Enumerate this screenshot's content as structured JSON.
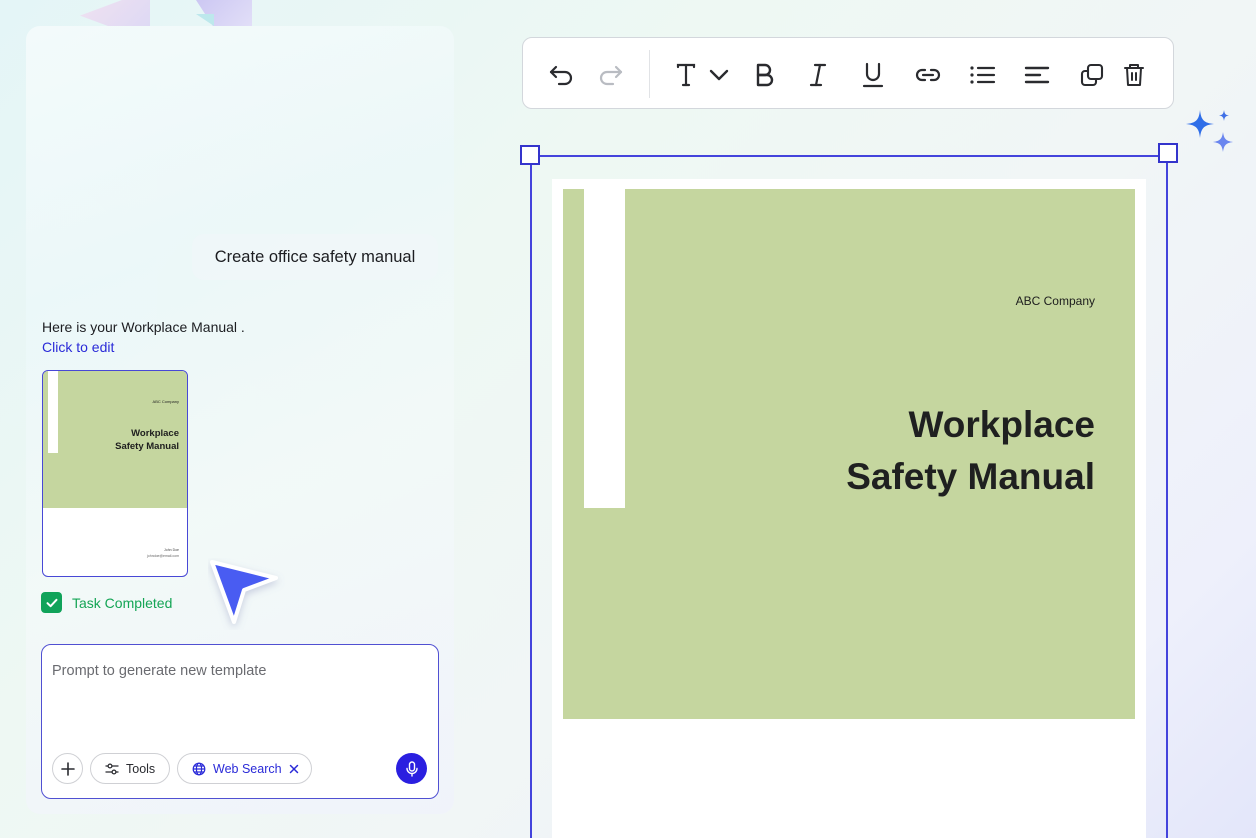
{
  "chat": {
    "user_message": "Create office safety manual",
    "assistant_message": "Here is your Workplace Manual .",
    "edit_link": "Click to edit",
    "thumbnail": {
      "company": "ABC Company",
      "title_line1": "Workplace",
      "title_line2": "Safety Manual",
      "footer_name": "John Doe",
      "footer_email": "johndoe@email.com"
    },
    "task_status": "Task Completed"
  },
  "prompt": {
    "placeholder": "Prompt to generate new template",
    "value": "",
    "tools_label": "Tools",
    "web_search_label": "Web Search"
  },
  "toolbar": {
    "icons": [
      "undo-icon",
      "redo-icon",
      "text-icon",
      "chevron-down-icon",
      "bold-icon",
      "italic-icon",
      "underline-icon",
      "link-icon",
      "bullet-list-icon",
      "align-left-icon",
      "duplicate-icon",
      "trash-icon"
    ]
  },
  "document": {
    "company": "ABC Company",
    "title_line1": "Workplace",
    "title_line2": "Safety Manual"
  },
  "colors": {
    "accent": "#2a1fe0",
    "selection": "#4444dc",
    "cover_green": "#c5d69f",
    "success": "#10a35a"
  }
}
